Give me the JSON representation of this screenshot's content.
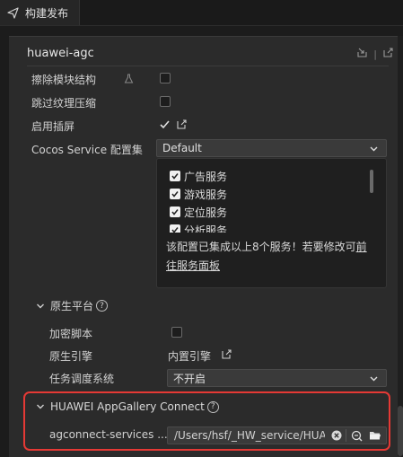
{
  "tab": {
    "label": "构建发布",
    "icon": "send-icon"
  },
  "section": {
    "title": "huawei-agc"
  },
  "options": [
    {
      "label": "擦除模块结构",
      "checked": false,
      "has_icon": true
    },
    {
      "label": "跳过纹理压缩",
      "checked": false
    },
    {
      "label": "启用插屏",
      "checked": true
    }
  ],
  "service_config": {
    "label": "Cocos Service 配置集",
    "value": "Default"
  },
  "services": [
    "广告服务",
    "游戏服务",
    "定位服务",
    "分析服务"
  ],
  "notice": {
    "text": "该配置已集成以上8个服务！若要修改可",
    "link": "前往服务面板"
  },
  "native": {
    "title": "原生平台",
    "encrypt_label": "加密脚本",
    "engine_label": "原生引擎",
    "engine_value": "内置引擎",
    "scheduler_label": "任务调度系统",
    "scheduler_value": "不开启"
  },
  "agc": {
    "title": "HUAWEI AppGallery Connect",
    "field_label": "agconnect-services ...",
    "path_value": "/Users/hsf/_HW_service/HUAWEI",
    "help": "?"
  },
  "colors": {
    "highlight": "#e53935",
    "panel": "#2b2b2b",
    "background": "#1c1c1c"
  }
}
